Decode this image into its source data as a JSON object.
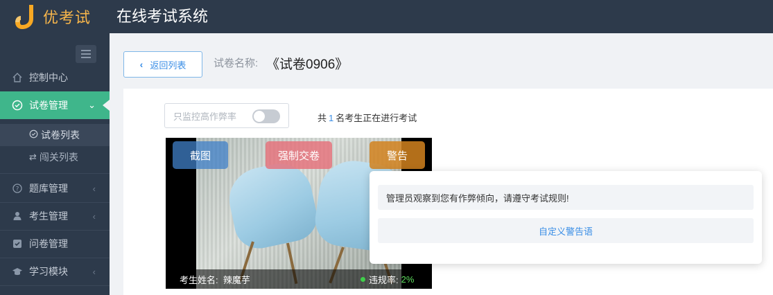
{
  "brand": {
    "logo_text": "优考试",
    "app_title": "在线考试系统"
  },
  "sidebar": {
    "items": [
      {
        "label": "控制中心",
        "icon": "home-icon"
      },
      {
        "label": "试卷管理",
        "icon": "check-circle-icon",
        "active": true
      },
      {
        "label": "题库管理",
        "icon": "question-circle-icon"
      },
      {
        "label": "考生管理",
        "icon": "user-icon"
      },
      {
        "label": "问卷管理",
        "icon": "checkbox-icon"
      },
      {
        "label": "学习模块",
        "icon": "graduation-cap-icon"
      }
    ],
    "sub_items": [
      {
        "label": "试卷列表",
        "icon": "check-circle-icon",
        "current": true
      },
      {
        "label": "闯关列表",
        "icon": "shuffle-icon"
      }
    ]
  },
  "header": {
    "back_label": "返回列表",
    "paper_label": "试卷名称:",
    "paper_name": "《试卷0906》"
  },
  "monitor": {
    "toggle_label": "只监控高作弊率",
    "toggle_on": false,
    "count_prefix": "共",
    "count": "1",
    "count_suffix": "名考生正在进行考试"
  },
  "video_card": {
    "screenshot_label": "截图",
    "force_submit_label": "强制交卷",
    "warn_label": "警告",
    "student_label": "考生姓名:",
    "student_name": "辣魔芋",
    "violation_label": "违规率:",
    "violation_rate": "2%"
  },
  "warn_popover": {
    "message": "管理员观察到您有作弊倾向，请遵守考试规则!",
    "custom_label": "自定义警告语"
  },
  "colors": {
    "accent": "#3fb68b",
    "link": "#3a8ee6",
    "sidebar_bg": "#2d3a4b",
    "logo": "#f7b64b"
  }
}
